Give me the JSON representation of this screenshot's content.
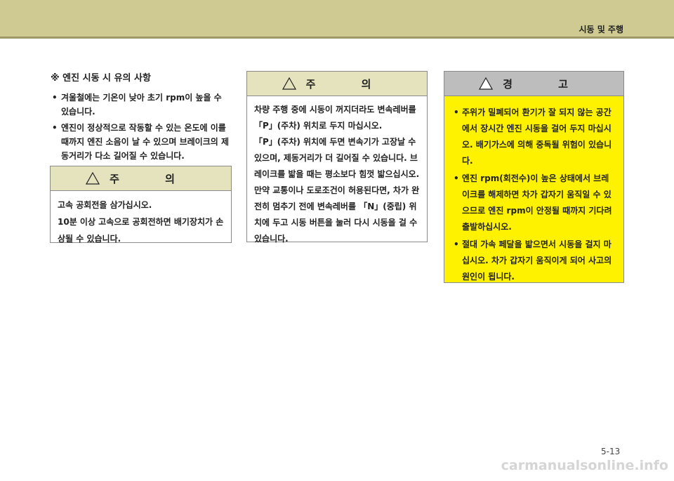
{
  "header": {
    "title": "시동 및 주행"
  },
  "note": {
    "heading": "※ 엔진 시동 시 유의 사항",
    "items": [
      "겨울철에는 기온이 낮아 초기 rpm이 높을 수 있습니다.",
      "엔진이 정상적으로 작동할 수 있는 온도에 이를 때까지 엔진 소음이 날 수 있으며 브레이크의 제동거리가 다소 길어질 수 있습니다."
    ]
  },
  "caution_left": {
    "title": "주 의",
    "lines": [
      "고속 공회전을 삼가십시오.",
      "10분 이상 고속으로 공회전하면 배기장치가 손상될 수 있습니다."
    ]
  },
  "caution_middle": {
    "title": "주 의",
    "lines": [
      "차량 주행 중에 시동이 꺼지더라도 변속레버를 「P」(주차) 위치로 두지 마십시오.",
      "「P」(주차) 위치에 두면 변속기가 고장날 수 있으며, 제동거리가 더 길어질 수 있습니다. 브레이크를 밟을 때는 평소보다 힘껏 밟으십시오. 만약 교통이나 도로조건이 허용된다면, 차가 완전히 멈추기 전에 변속레버를 「N」(중립) 위치에 두고 시동 버튼을 눌러 다시 시동을 걸 수 있습니다."
    ]
  },
  "warning": {
    "title": "경 고",
    "items": [
      "주위가 밀폐되어 환기가 잘 되지 않는 공간에서 장시간 엔진 시동을 걸어 두지 마십시오. 배기가스에 의해 중독될 위험이 있습니다.",
      "엔진 rpm(회전수)이 높은 상태에서 브레이크를 해제하면 차가 갑자기 움직일 수 있으므로 엔진 rpm이 안정될 때까지 기다려 출발하십시오.",
      "절대 가속 페달을 밟으면서 시동을 걸지 마십시오. 차가 갑자기 움직이게 되어 사고의 원인이 됩니다."
    ]
  },
  "footer": {
    "page_number": "5-13",
    "watermark": "carmanualsonline.info"
  },
  "icons": {
    "warning": "warning-triangle-icon"
  },
  "colors": {
    "header_bg": "#cfc992",
    "caution_head_bg": "#e5e3bd",
    "warning_bg": "#fff200",
    "warning_head_bg": "#bdbdbd"
  }
}
